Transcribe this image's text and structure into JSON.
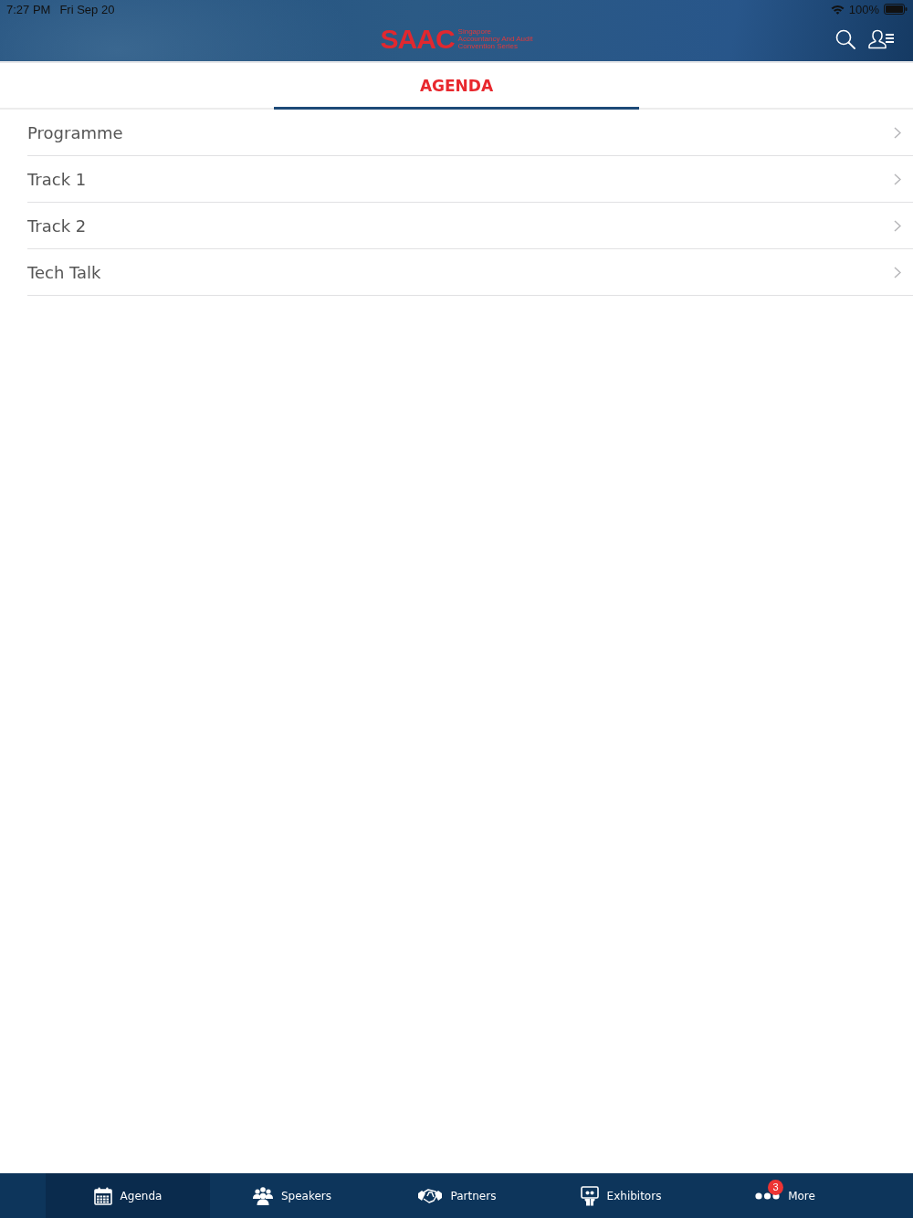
{
  "status_bar": {
    "time": "7:27 PM",
    "date": "Fri Sep 20",
    "battery": "100%"
  },
  "header": {
    "logo": {
      "mark": "SAAC",
      "lines": [
        "Singapore",
        "Accountancy And Audit",
        "Convention Series"
      ]
    }
  },
  "tabs": [
    {
      "label": "AGENDA",
      "selected": true
    }
  ],
  "list": {
    "items": [
      {
        "label": "Programme"
      },
      {
        "label": "Track 1"
      },
      {
        "label": "Track 2"
      },
      {
        "label": "Tech Talk"
      }
    ]
  },
  "tab_bar": {
    "items": [
      {
        "label": "Agenda",
        "kind": "calendar",
        "selected": true
      },
      {
        "label": "Speakers",
        "kind": "people",
        "selected": false
      },
      {
        "label": "Partners",
        "kind": "handshake",
        "selected": false
      },
      {
        "label": "Exhibitors",
        "kind": "exhibitor",
        "selected": false
      },
      {
        "label": "More",
        "kind": "dots",
        "selected": false,
        "badge": "3"
      }
    ]
  }
}
